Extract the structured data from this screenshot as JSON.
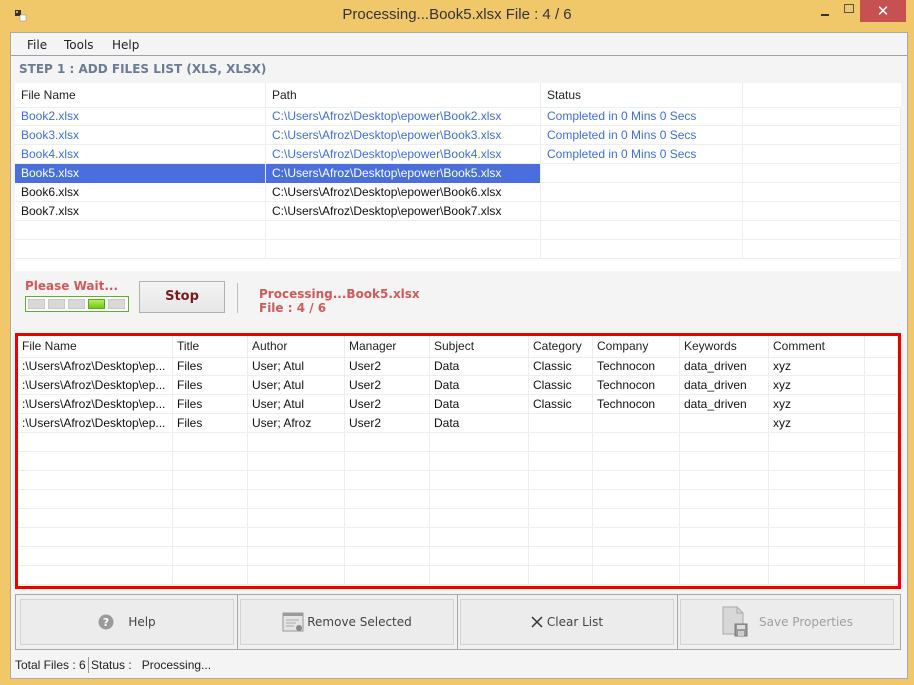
{
  "window": {
    "title": "Processing...Book5.xlsx File : 4 / 6",
    "minimize_icon": "minimize-icon",
    "maximize_icon": "maximize-icon",
    "close_icon": "close-icon"
  },
  "menu": [
    "File",
    "Tools",
    "Help"
  ],
  "step_label": "STEP 1 : ADD FILES LIST (XLS, XLSX)",
  "file_list": {
    "columns": [
      "File Name",
      "Path",
      "Status",
      ""
    ],
    "rows": [
      {
        "name": "Book2.xlsx",
        "path": "C:\\Users\\Afroz\\Desktop\\epower\\Book2.xlsx",
        "status": "Completed in 0 Mins 0 Secs",
        "state": "done"
      },
      {
        "name": "Book3.xlsx",
        "path": "C:\\Users\\Afroz\\Desktop\\epower\\Book3.xlsx",
        "status": "Completed in 0 Mins 0 Secs",
        "state": "done"
      },
      {
        "name": "Book4.xlsx",
        "path": "C:\\Users\\Afroz\\Desktop\\epower\\Book4.xlsx",
        "status": "Completed in 0 Mins 0 Secs",
        "state": "done"
      },
      {
        "name": "Book5.xlsx",
        "path": "C:\\Users\\Afroz\\Desktop\\epower\\Book5.xlsx",
        "status": "",
        "state": "selected"
      },
      {
        "name": "Book6.xlsx",
        "path": "C:\\Users\\Afroz\\Desktop\\epower\\Book6.xlsx",
        "status": "",
        "state": "pending"
      },
      {
        "name": "Book7.xlsx",
        "path": "C:\\Users\\Afroz\\Desktop\\epower\\Book7.xlsx",
        "status": "",
        "state": "pending"
      }
    ]
  },
  "progress": {
    "wait_label": "Please Wait...",
    "segments": 5,
    "active_segment": 4,
    "stop_label": "Stop",
    "processing_label": "Processing...Book5.xlsx",
    "file_count_label": "File : 4 / 6"
  },
  "properties": {
    "columns": [
      "File Name",
      "Title",
      "Author",
      "Manager",
      "Subject",
      "Category",
      "Company",
      "Keywords",
      "Comment",
      ""
    ],
    "rows": [
      [
        ":\\Users\\Afroz\\Desktop\\ep...",
        "Files",
        "User; Atul",
        "User2",
        "Data",
        "Classic",
        "Technocon",
        "data_driven",
        "xyz"
      ],
      [
        ":\\Users\\Afroz\\Desktop\\ep...",
        "Files",
        "User; Atul",
        "User2",
        "Data",
        "Classic",
        "Technocon",
        "data_driven",
        "xyz"
      ],
      [
        ":\\Users\\Afroz\\Desktop\\ep...",
        "Files",
        "User; Atul",
        "User2",
        "Data",
        "Classic",
        "Technocon",
        "data_driven",
        "xyz"
      ],
      [
        ":\\Users\\Afroz\\Desktop\\ep...",
        "Files",
        "User; Afroz",
        "User2",
        "Data",
        "",
        "",
        "",
        "xyz"
      ]
    ]
  },
  "buttons": {
    "help": "Help",
    "remove_selected": "Remove Selected",
    "clear_list": "Clear List",
    "save_properties": "Save Properties"
  },
  "statusbar": {
    "total_files": "Total Files : 6",
    "status": "Status :   Processing..."
  },
  "colors": {
    "frame": "#f0c86a",
    "selection": "#4a6fdc",
    "completed_text": "#3f6fd8",
    "highlight_border": "#ee0000",
    "progress_text": "#d05a5a"
  }
}
